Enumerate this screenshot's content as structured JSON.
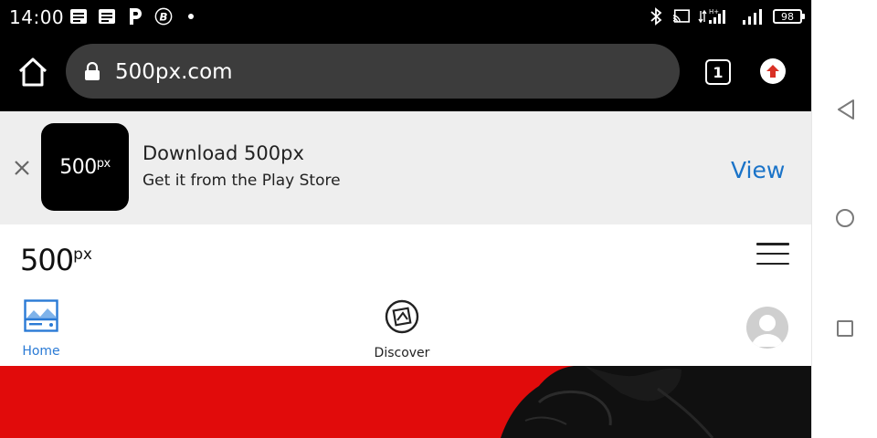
{
  "status_bar": {
    "time": "14:00",
    "battery": "98",
    "left_icons": [
      "notes-icon",
      "notes-icon",
      "parking-icon",
      "bitcoin-icon"
    ],
    "right_icons": [
      "bluetooth-icon",
      "cast-icon",
      "signal-icon",
      "signal-icon"
    ]
  },
  "browser": {
    "url": "500px.com",
    "tab_count": "1"
  },
  "app_banner": {
    "icon_text_main": "500",
    "icon_text_sup": "px",
    "title": "Download 500px",
    "subtitle": "Get it from the Play Store",
    "action_label": "View",
    "action_color": "#1a73c8"
  },
  "site": {
    "logo_main": "500",
    "logo_sup": "px",
    "nav": [
      {
        "label": "Home",
        "icon": "home-image-icon",
        "active": true
      },
      {
        "label": "Discover",
        "icon": "discover-icon",
        "active": false
      }
    ],
    "hero_color": "#e10b0b"
  },
  "system_nav": [
    "back-icon",
    "home-circle-icon",
    "recents-icon"
  ]
}
